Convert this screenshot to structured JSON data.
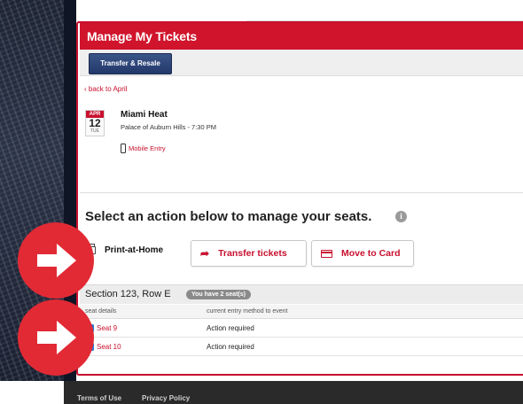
{
  "header": {
    "title": "Manage My Tickets"
  },
  "toolbar": {
    "transfer_resale_label": "Transfer & Resale"
  },
  "nav": {
    "back_link": "back to April"
  },
  "event": {
    "month": "APR",
    "day": "12",
    "weekday": "TUE",
    "name": "Miami Heat",
    "venue_time": "Palace of Auburn Hills - 7:30 PM",
    "entry_type": "Mobile Entry"
  },
  "actions": {
    "heading": "Select an action below to manage your seats.",
    "info_glyph": "i",
    "print_label": "Print-at-Home",
    "transfer_label": "Transfer tickets",
    "card_label": "Move to Card"
  },
  "section": {
    "label": "Section 123, Row E",
    "seat_count_badge": "You have 2 seat(s)"
  },
  "table": {
    "headers": [
      "seat details",
      "current entry method to event"
    ],
    "rows": [
      {
        "seat": "Seat 9",
        "status": "Action required",
        "checked": true
      },
      {
        "seat": "Seat 10",
        "status": "Action required",
        "checked": true
      }
    ]
  },
  "footer": {
    "links": [
      "Terms of Use",
      "Privacy Policy"
    ]
  },
  "colors": {
    "brand_red": "#d0142c",
    "nav_blue": "#2b3f73",
    "arrow_red": "#e22a35",
    "checkbox_blue": "#2a78d4"
  },
  "icons": [
    "chevron-left-icon",
    "phone-icon",
    "info-icon",
    "printer-icon",
    "share-arrow-icon",
    "card-icon",
    "checkbox-icon",
    "arrow-right-icon"
  ]
}
